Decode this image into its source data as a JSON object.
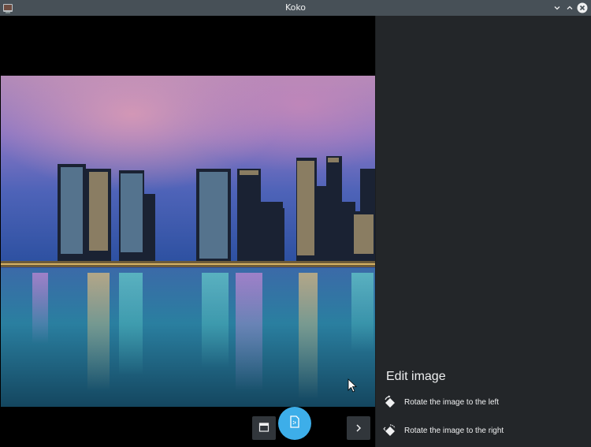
{
  "window": {
    "title": "Koko",
    "app_icon": "koko-app-icon",
    "controls": [
      "minimize-icon",
      "maximize-icon",
      "close-icon"
    ]
  },
  "viewer": {
    "image_subject": "city-skyline-night",
    "toolbar": {
      "thumbnails_icon": "thumbnails-icon",
      "edit_icon": "edit-image-icon",
      "next_icon": "chevron-right-icon"
    }
  },
  "sidebar": {
    "heading": "Edit image",
    "actions": [
      {
        "label": "Rotate the image to the left",
        "icon": "rotate-left-icon"
      },
      {
        "label": "Rotate the image to the right",
        "icon": "rotate-right-icon"
      }
    ]
  },
  "colors": {
    "accent": "#3daee9",
    "titlebar": "#475057",
    "sidebar": "#232629",
    "viewer_bg": "#000000"
  }
}
